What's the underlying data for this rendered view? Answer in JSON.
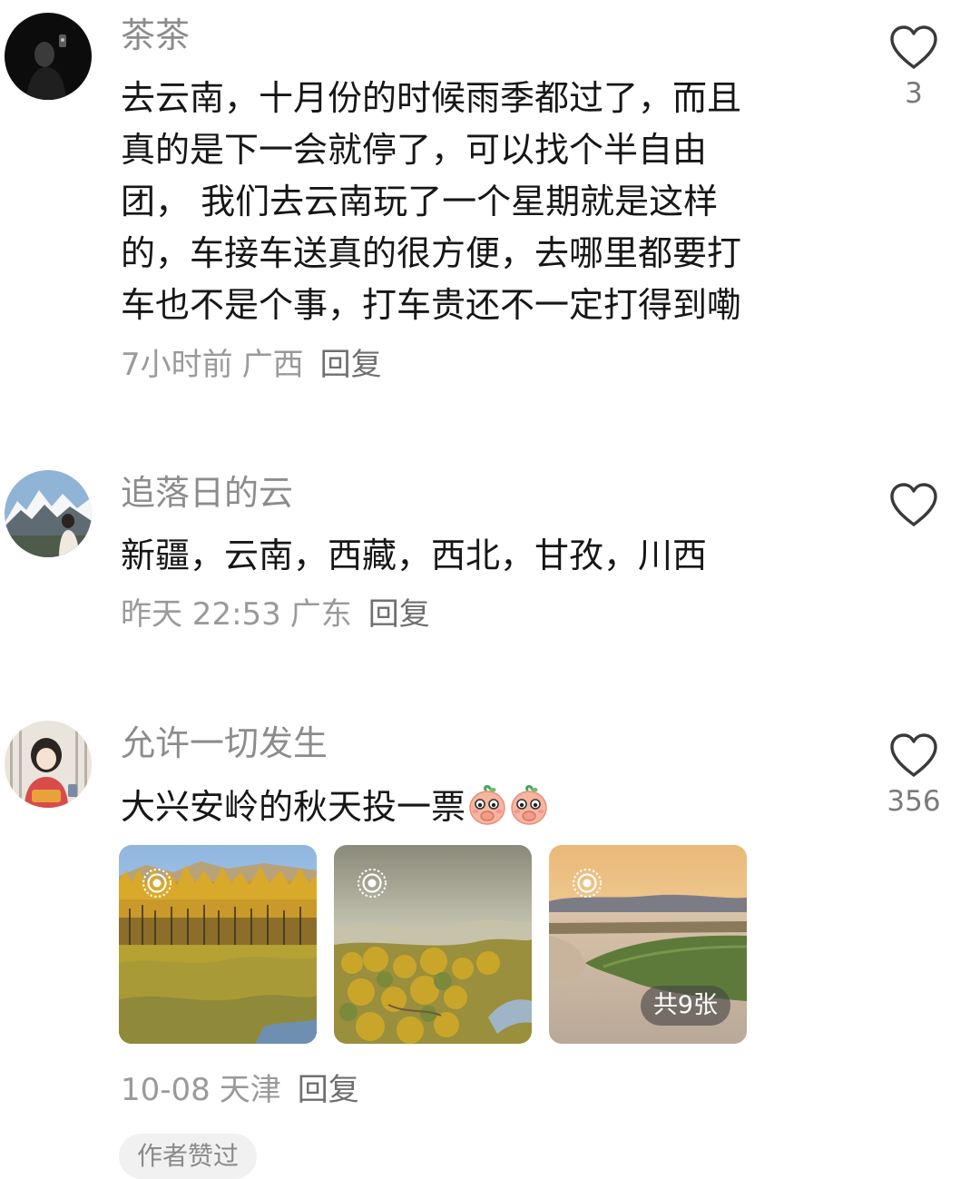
{
  "comments": [
    {
      "username": "茶茶",
      "lines": [
        "去云南，十月份的时候雨季都过了，而且",
        "真的是下一会就停了，可以找个半自由",
        "团， 我们去云南玩了一个星期就是这样",
        "的，车接车送真的很方便，去哪里都要打",
        "车也不是个事，打车贵还不一定打得到嘞"
      ],
      "time": "7小时前",
      "location": "广西",
      "reply_label": "回复",
      "like_count": "3",
      "like_icon": "heart-outline-icon"
    },
    {
      "username": "追落日的云",
      "lines": [
        "新疆，云南，西藏，西北，甘孜，川西"
      ],
      "time": "昨天 22:53",
      "location": "广东",
      "reply_label": "回复",
      "like_count": "",
      "like_icon": "heart-outline-icon"
    },
    {
      "username": "允许一切发生",
      "lines": [
        "大兴安岭的秋天投一票"
      ],
      "emojis": [
        "shy-peach-emoji",
        "shy-peach-emoji"
      ],
      "photo_count_label": "共9张",
      "photo_icon": "live-photo-icon",
      "time": "10-08",
      "location": "天津",
      "reply_label": "回复",
      "like_count": "356",
      "like_icon": "heart-outline-icon",
      "author_liked_label": "作者赞过"
    }
  ],
  "colors": {
    "username": "#8c8c8c",
    "body": "#161616",
    "meta": "#9a9a9a",
    "heart_stroke": "#3a3a3a",
    "badge_bg": "#f1f1f1"
  }
}
